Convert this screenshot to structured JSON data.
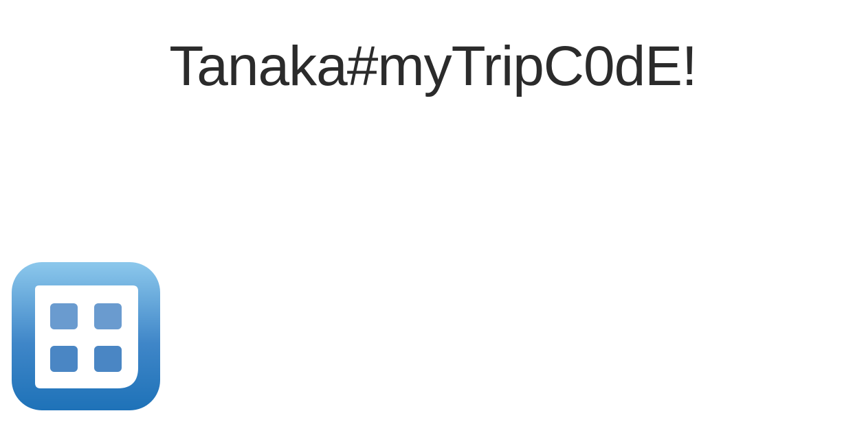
{
  "heading": {
    "text": "Tanaka#myTripC0dE!"
  },
  "logo": {
    "icon": "grid-app-icon",
    "wordmark": "",
    "gradient_top": "#8cc8ec",
    "gradient_bottom": "#1e72b8",
    "tile_color": "#4a86c4"
  }
}
